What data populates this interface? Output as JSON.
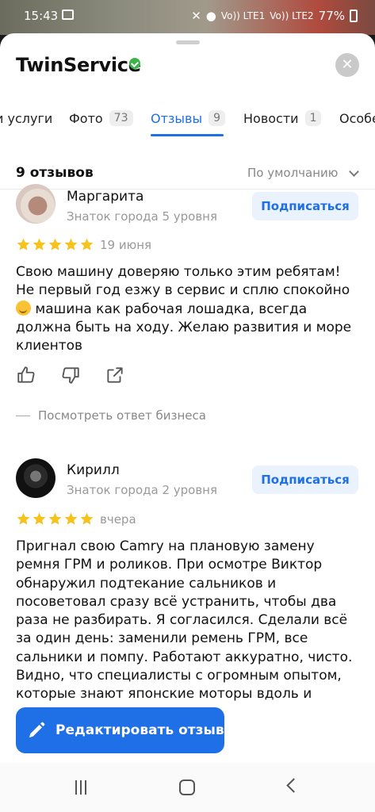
{
  "status": {
    "time": "15:43",
    "net1": "Vo)) LTE1",
    "net2": "Vo)) LTE2",
    "battery": "77%"
  },
  "header": {
    "title": "TwinService",
    "close": "✕"
  },
  "tabs": [
    {
      "label": "и услуги",
      "count": ""
    },
    {
      "label": "Фото",
      "count": "73"
    },
    {
      "label": "Отзывы",
      "count": "9"
    },
    {
      "label": "Новости",
      "count": "1"
    },
    {
      "label": "Особе",
      "count": ""
    }
  ],
  "reviews_header": {
    "count_label": "9 отзывов",
    "sort": "По умолчанию"
  },
  "reviews": [
    {
      "name": "Маргарита",
      "level": "Знаток города 5 уровня",
      "subscribe": "Подписаться",
      "rating": 5,
      "date": "19 июня",
      "text_before": "Свою машину доверяю только этим ребятам! Не первый год езжу в сервис и сплю спокойно ",
      "emoji": "smiling-face-icon",
      "text_after": " машина как рабочая лошадка, всегда должна быть на ходу. Желаю развития и море клиентов",
      "business_reply": "Посмотреть ответ бизнеса"
    },
    {
      "name": "Кирилл",
      "level": "Знаток города 2 уровня",
      "subscribe": "Подписаться",
      "rating": 5,
      "date": "вчера",
      "text": "Пригнал свою Camry на плановую замену ремня ГРМ и роликов. При осмотре Виктор обнаружил подтекание сальников и посоветовал сразу всё устранить, чтобы два раза не разбирать. Я согласился. Сделали всё за один день: заменили ремень ГРМ, все сальники и помпу. Работают аккуратно, чисто. Видно, что специалисты с огромным опытом, которые знают японские моторы вдоль и"
    }
  ],
  "fab": {
    "label": "Редактировать отзыв"
  },
  "colors": {
    "accent": "#1f6fe6",
    "star": "#f6c21c",
    "verified": "#3bb54a"
  }
}
